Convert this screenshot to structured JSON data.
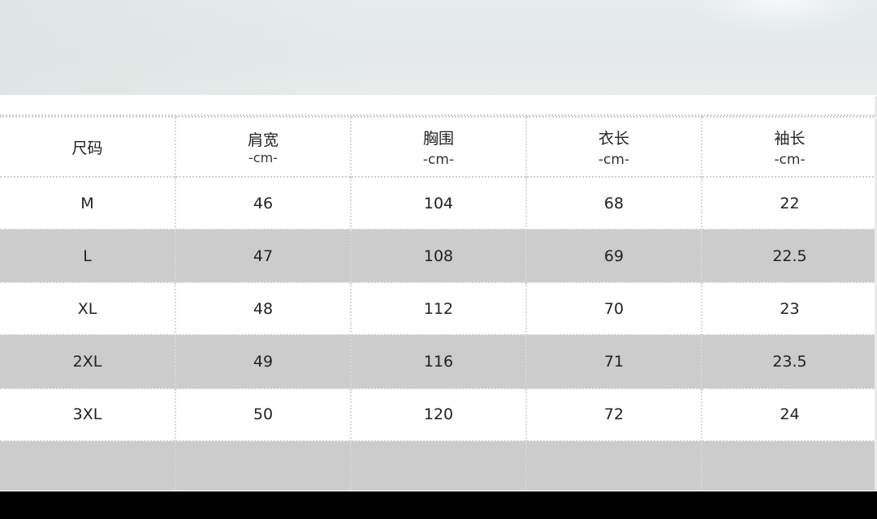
{
  "table": {
    "headers": [
      {
        "name": "尺码",
        "unit": ""
      },
      {
        "name": "肩宽",
        "unit": "-cm-"
      },
      {
        "name": "胸围",
        "unit": "-cm-"
      },
      {
        "name": "衣长",
        "unit": "-cm-"
      },
      {
        "name": "袖长",
        "unit": "-cm-"
      }
    ],
    "rows": [
      [
        "M",
        "46",
        "104",
        "68",
        "22"
      ],
      [
        "L",
        "47",
        "108",
        "69",
        "22.5"
      ],
      [
        "XL",
        "48",
        "112",
        "70",
        "23"
      ],
      [
        "2XL",
        "49",
        "116",
        "71",
        "23.5"
      ],
      [
        "3XL",
        "50",
        "120",
        "72",
        "24"
      ]
    ]
  }
}
